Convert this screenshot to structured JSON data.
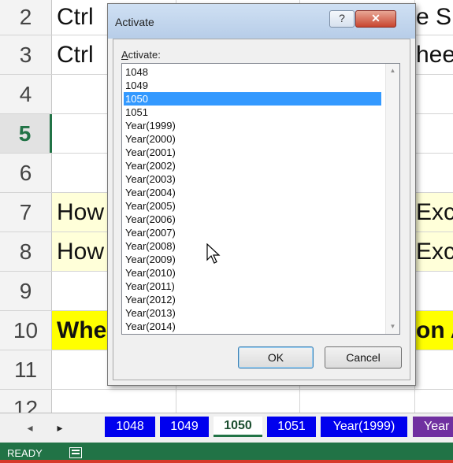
{
  "rows": [
    {
      "num": "2",
      "left": "Ctrl",
      "right": "e Sh",
      "style": "",
      "selected": false
    },
    {
      "num": "3",
      "left": "Ctrl",
      "right": "heet",
      "style": "",
      "selected": false
    },
    {
      "num": "4",
      "left": "",
      "right": "",
      "style": "",
      "selected": false
    },
    {
      "num": "5",
      "left": "",
      "right": "",
      "style": "",
      "selected": true
    },
    {
      "num": "6",
      "left": "",
      "right": "",
      "style": "",
      "selected": false
    },
    {
      "num": "7",
      "left": "How",
      "right": "Exc",
      "style": "yellow-lt",
      "selected": false
    },
    {
      "num": "8",
      "left": "How",
      "right": "Exc",
      "style": "yellow-lt",
      "selected": false
    },
    {
      "num": "9",
      "left": "",
      "right": "",
      "style": "",
      "selected": false
    },
    {
      "num": "10",
      "left": "Whe",
      "right": "on A",
      "style": "yellow",
      "selected": false
    },
    {
      "num": "11",
      "left": "",
      "right": "",
      "style": "",
      "selected": false
    },
    {
      "num": "12",
      "left": "",
      "right": "",
      "style": "",
      "selected": false
    }
  ],
  "dialog": {
    "title": "Activate",
    "help_label": "?",
    "close_label": "✕",
    "list_label_key": "A",
    "list_label_rest": "ctivate:",
    "items": [
      "1048",
      "1049",
      "1050",
      "1051",
      "Year(1999)",
      "Year(2000)",
      "Year(2001)",
      "Year(2002)",
      "Year(2003)",
      "Year(2004)",
      "Year(2005)",
      "Year(2006)",
      "Year(2007)",
      "Year(2008)",
      "Year(2009)",
      "Year(2010)",
      "Year(2011)",
      "Year(2012)",
      "Year(2013)",
      "Year(2014)"
    ],
    "selected_item": "1050",
    "ok_label": "OK",
    "cancel_label": "Cancel",
    "scroll_up_icon": "▲",
    "scroll_down_icon": "▼"
  },
  "tabs": {
    "prev_icon": "◂",
    "next_icon": "▸",
    "items": [
      {
        "label": "1048",
        "state": "blue"
      },
      {
        "label": "1049",
        "state": "blue"
      },
      {
        "label": "1050",
        "state": "active"
      },
      {
        "label": "1051",
        "state": "blue"
      },
      {
        "label": "Year(1999)",
        "state": "blue"
      },
      {
        "label": "Year",
        "state": "purple"
      }
    ]
  },
  "status": {
    "ready": "READY"
  },
  "colors": {
    "excel_green": "#217346",
    "tab_blue": "#0000ee",
    "tab_purple": "#7030a0",
    "highlight_yellow": "#ffff00",
    "list_selection": "#3399ff"
  }
}
